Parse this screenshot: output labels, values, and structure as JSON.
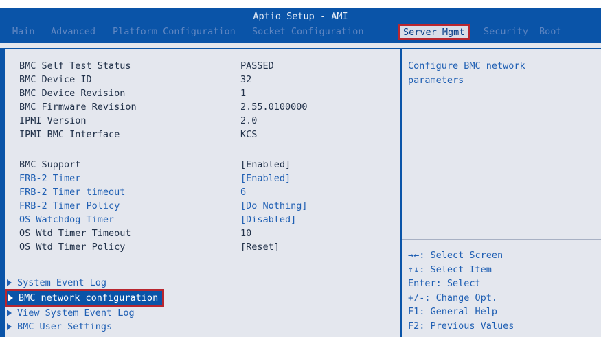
{
  "app_title": "Aptio Setup - AMI",
  "tabs": [
    {
      "label": "Main"
    },
    {
      "label": "Advanced"
    },
    {
      "label": "Platform Configuration"
    },
    {
      "label": "Socket Configuration"
    },
    {
      "label": "Server Mgmt",
      "active": true
    },
    {
      "label": "Security"
    },
    {
      "label": "Boot"
    }
  ],
  "info_items": [
    {
      "label": "BMC Self Test Status",
      "value": "PASSED"
    },
    {
      "label": "BMC Device ID",
      "value": "32"
    },
    {
      "label": "BMC Device Revision",
      "value": "1"
    },
    {
      "label": "BMC Firmware Revision",
      "value": "2.55.0100000"
    },
    {
      "label": "IPMI Version",
      "value": "2.0"
    },
    {
      "label": "IPMI BMC Interface",
      "value": "KCS"
    }
  ],
  "settings": [
    {
      "label": "BMC Support",
      "value": "[Enabled]",
      "editable": false
    },
    {
      "label": "FRB-2 Timer",
      "value": "[Enabled]",
      "editable": true
    },
    {
      "label": "FRB-2 Timer timeout",
      "value": "6",
      "editable": true
    },
    {
      "label": "FRB-2 Timer Policy",
      "value": "[Do Nothing]",
      "editable": true
    },
    {
      "label": "OS Watchdog Timer",
      "value": "[Disabled]",
      "editable": true
    },
    {
      "label": "OS Wtd Timer Timeout",
      "value": "10",
      "editable": false
    },
    {
      "label": "OS Wtd Timer Policy",
      "value": "[Reset]",
      "editable": false
    }
  ],
  "submenus": [
    {
      "label": "System Event Log"
    },
    {
      "label": "BMC network configuration",
      "selected": true
    },
    {
      "label": "View System Event Log"
    },
    {
      "label": "BMC User Settings"
    }
  ],
  "help": {
    "description": "Configure BMC network\nparameters"
  },
  "key_help": [
    "→←: Select Screen",
    "↑↓: Select Item",
    "Enter: Select",
    "+/-: Change Opt.",
    "F1: General Help",
    "F2: Previous Values"
  ],
  "colors": {
    "background": "#0a54a8",
    "panel": "#e4e7ee",
    "link_text": "#1f5fb3",
    "static_text": "#22324a",
    "highlight_outline": "#b8262f"
  }
}
